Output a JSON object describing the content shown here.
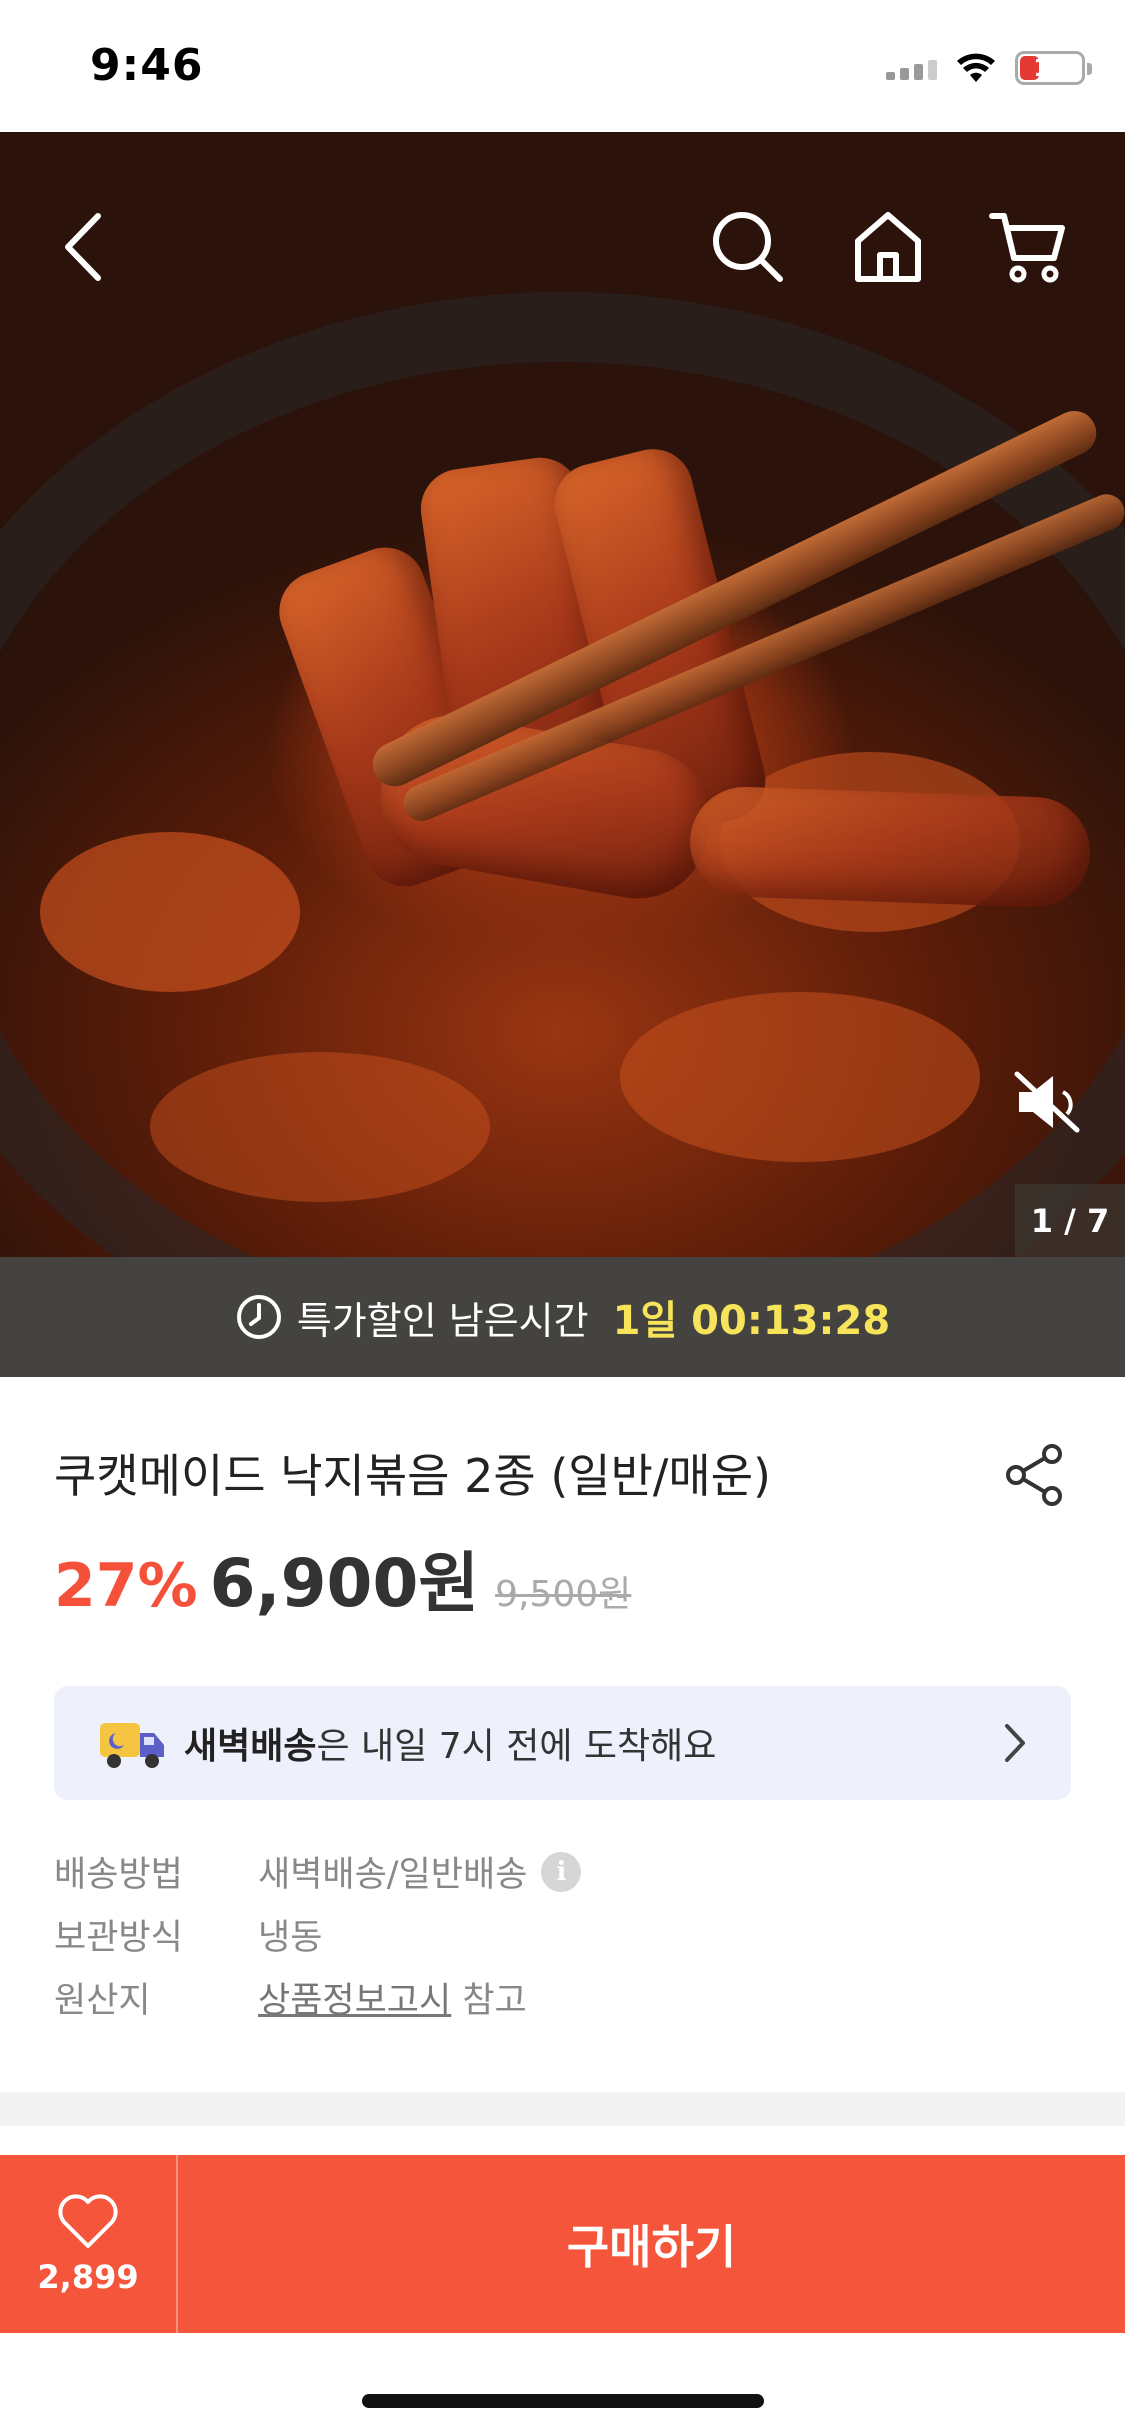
{
  "status_bar": {
    "time": "9:46",
    "battery": "12",
    "battery_level": 0.12
  },
  "hero": {
    "page_indicator": "1 / 7",
    "icons": {
      "back": "chevron-left-icon",
      "search": "search-icon",
      "home": "home-icon",
      "cart": "cart-icon",
      "mute": "speaker-muted-icon"
    }
  },
  "timer": {
    "label": "특가할인 남은시간",
    "value": "1일 00:13:28",
    "icon": "clock-icon"
  },
  "product": {
    "title": "쿠캣메이드 낙지볶음 2종 (일반/매운)",
    "discount": "27%",
    "price": "6,900원",
    "original_price": "9,500원"
  },
  "delivery_banner": {
    "bold": "새벽배송",
    "rest": "은 내일 7시 전에 도착해요"
  },
  "info": [
    {
      "key": "배송방법",
      "value": "새벽배송/일반배송"
    },
    {
      "key": "보관방식",
      "value": "냉동"
    },
    {
      "key": "원산지",
      "link": "상품정보고시",
      "suffix": " 참고"
    }
  ],
  "bottom_bar": {
    "like_count": "2,899",
    "buy_label": "구매하기"
  },
  "colors": {
    "accent": "#f5563b",
    "timer_bg": "#454340",
    "timer_value": "#f7e45a",
    "discount": "#f4503a",
    "banner_bg": "#eef0fb"
  }
}
